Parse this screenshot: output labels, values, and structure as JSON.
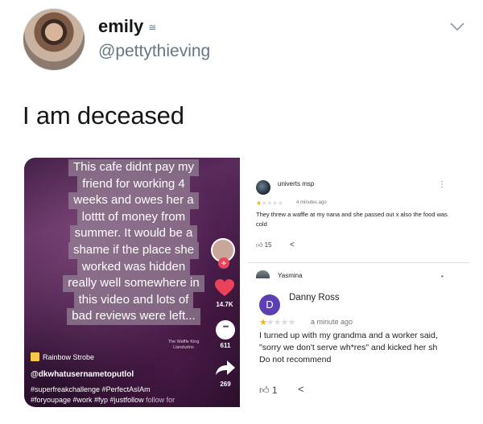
{
  "tweet": {
    "display_name": "emily",
    "name_mark": "≅",
    "handle": "@pettythieving",
    "text": "I am deceased",
    "more_icon": "chevron-down-icon"
  },
  "tiktok": {
    "overlay_lines": [
      "This cafe didnt pay my",
      "friend for working 4",
      "weeks and owes her a",
      "lotttt of money from",
      "summer. It would be a",
      "shame if the place she",
      "worked was hidden",
      "really well somewhere in",
      "this video and lots of",
      "bad reviews were left..."
    ],
    "plus": "+",
    "likes": "14.7K",
    "comments": "611",
    "shares": "269",
    "store_sign": "The Waffle King Llandudno",
    "music": "Rainbow Strobe",
    "username": "@dkwhatusernametoputlol",
    "tags_line1": "#superfreakchallenge #PerfectAsIAm",
    "tags_line2": "#foryoupage #work #fyp #justfollow",
    "tags_follow": "follow for"
  },
  "review1": {
    "name": "univerts msp",
    "rating": 1,
    "max_rating": 5,
    "time": "4 minutes ago",
    "text": "They threw a waffle at my nana and she passed out x also the food was cold",
    "likes": "15",
    "kebab": "⋮"
  },
  "review2_header": {
    "name": "Yasmina",
    "dot": "•"
  },
  "review2": {
    "avatar_letter": "D",
    "name": "Danny Ross",
    "rating": 1,
    "max_rating": 5,
    "time": "a minute ago",
    "text_lines": [
      "I turned up with my grandma and a worker said,",
      "\"sorry we don't serve wh*res\" and kicked her sh",
      "Do not recommend"
    ],
    "likes": "1"
  },
  "colors": {
    "star_on": "#f5b400",
    "star_off": "#dadce0",
    "tiktok_heart": "#ea4359",
    "avatar_d": "#5c3fb2"
  }
}
